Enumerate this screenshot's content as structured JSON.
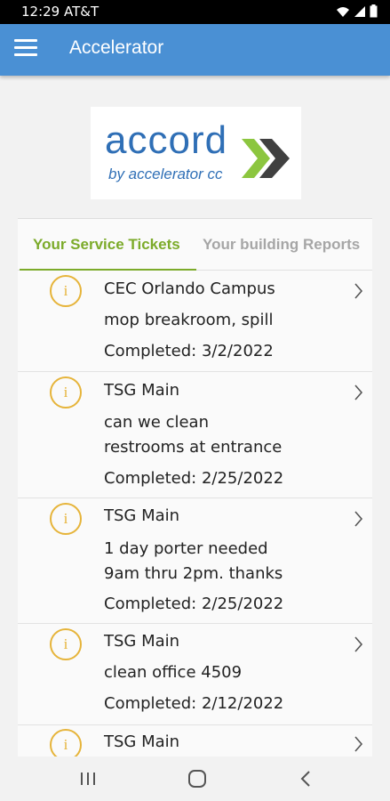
{
  "status": {
    "time": "12:29 AT&T"
  },
  "app": {
    "title": "Accelerator"
  },
  "logo": {
    "main": "accord",
    "sub": "by accelerator cc"
  },
  "tabs": [
    {
      "label": "Your Service Tickets"
    },
    {
      "label": "Your building Reports"
    }
  ],
  "tickets": [
    {
      "location": "CEC Orlando Campus",
      "description": [
        "mop breakroom, spill"
      ],
      "status": "Completed: 3/2/2022"
    },
    {
      "location": "TSG Main",
      "description": [
        "can we clean",
        "restrooms at entrance"
      ],
      "status": "Completed: 2/25/2022"
    },
    {
      "location": "TSG Main",
      "description": [
        "1 day porter needed",
        "9am thru 2pm. thanks"
      ],
      "status": "Completed: 2/25/2022"
    },
    {
      "location": "TSG Main",
      "description": [
        "clean office 4509"
      ],
      "status": "Completed: 2/12/2022"
    },
    {
      "location": "TSG Main",
      "description": [],
      "status": ""
    }
  ],
  "colors": {
    "app_bar": "#4a90d4",
    "accent_green": "#7cab2a",
    "info_yellow": "#e6b43a",
    "logo_blue": "#2f6fb6"
  },
  "icons": {
    "menu": "menu-icon",
    "info": "info-icon",
    "chevron": "chevron-right-icon"
  }
}
